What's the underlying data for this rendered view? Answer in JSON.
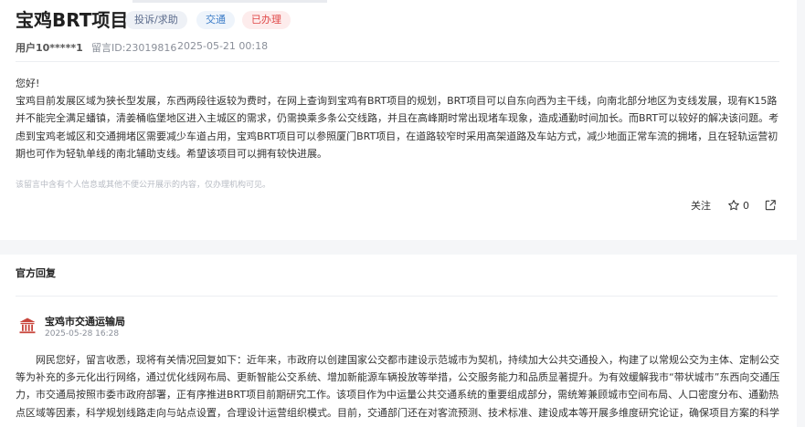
{
  "page": {
    "title": "宝鸡BRT项目",
    "tags": [
      "投诉/求助",
      "交通",
      "已办理"
    ],
    "user": "用户10*****1",
    "message_id": "留言ID:23019816",
    "datetime": "2025-05-21 00:18"
  },
  "message": {
    "greeting": "您好!",
    "body": "宝鸡目前发展区域为狭长型发展，东西两段往返较为费时，在网上查询到宝鸡有BRT项目的规划，BRT项目可以自东向西为主干线，向南北部分地区为支线发展，现有K15路并不能完全满足蟠镇，清姜桶临堡地区进入主城区的需求，仍需换乘多条公交线路，并且在高峰期时常出现堵车现象，造成通勤时间加长。而BRT可以较好的解决该问题。考虑到宝鸡老城区和交通拥堵区需要减少车道占用，宝鸡BRT项目可以参照厦门BRT项目，在道路较窄时采用高架道路及车站方式，减少地面正常车流的拥堵，且在轻轨运营初期也可作为轻轨单线的南北辅助支线。希望该项目可以拥有较快进展。",
    "notice": "该留言中含有个人信息或其他不便公开展示的内容，仅办理机构可见。"
  },
  "actions": {
    "follow": "关注",
    "like_count": "0"
  },
  "reply": {
    "section_title": "官方回复",
    "org_name": "宝鸡市交通运输局",
    "org_time": "2025-05-28 16:28",
    "text": "网民您好，留言收悉，现将有关情况回复如下：近年来，市政府以创建国家公交都市建设示范城市为契机，持续加大公共交通投入，构建了以常规公交为主体、定制公交等为补充的多元化出行网络，通过优化线网布局、更新智能公交系统、增加新能源车辆投放等举措，公交服务能力和品质显著提升。为有效缓解我市“带状城市”东西向交通压力，市交通局按照市委市政府部署，正有序推进BRT项目前期研究工作。该项目作为中运量公共交通系统的重要组成部分，需统筹兼顾城市空间布局、人口密度分布、通勤热点区域等因素，科学规划线路走向与站点设置，合理设计运营组织模式。目前，交通部门还在对客流预测、技术标准、建设成本等开展多维度研究论证，确保项目方案的科学"
  }
}
